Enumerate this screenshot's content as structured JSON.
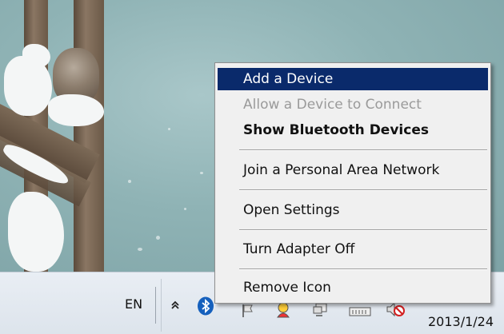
{
  "context_menu": {
    "items": [
      {
        "label": "Add a Device",
        "state": "highlighted"
      },
      {
        "label": "Allow a Device to Connect",
        "state": "disabled"
      },
      {
        "label": "Show Bluetooth Devices",
        "state": "default-bold"
      },
      {
        "label": "Join a Personal Area Network",
        "state": "normal"
      },
      {
        "label": "Open Settings",
        "state": "normal"
      },
      {
        "label": "Turn Adapter Off",
        "state": "normal"
      },
      {
        "label": "Remove Icon",
        "state": "normal"
      }
    ],
    "highlight_color": "#0a2a6b"
  },
  "taskbar": {
    "language": "EN",
    "date": "2013/1/24",
    "tray_icons": [
      "show-hidden-icons-chevron",
      "bluetooth-icon",
      "flag-icon",
      "messenger-icon",
      "monitor-icon",
      "network-icon",
      "volume-muted-icon"
    ]
  },
  "colors": {
    "bluetooth": "#1560bd",
    "mute": "#d21f1f"
  }
}
